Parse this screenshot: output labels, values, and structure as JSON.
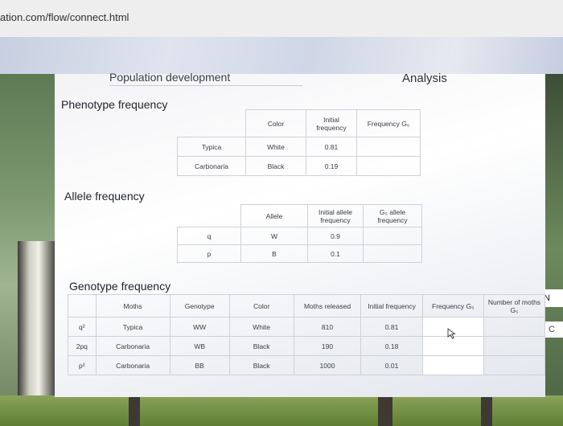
{
  "browser": {
    "url": "ation.com/flow/connect.html"
  },
  "header": {
    "title": "Population development",
    "analysis": "Analysis"
  },
  "sections": {
    "phenotype": "Phenotype frequency",
    "allele": "Allele frequency",
    "genotype": "Genotype frequency"
  },
  "phenotype_table": {
    "headers": [
      "Color",
      "Initial frequency",
      "Frequency G₅"
    ],
    "rows": [
      {
        "name": "Typica",
        "color": "White",
        "initial": "0.81",
        "freq": ""
      },
      {
        "name": "Carbonaria",
        "color": "Black",
        "initial": "0.19",
        "freq": ""
      }
    ]
  },
  "allele_table": {
    "headers": [
      "Allele",
      "Initial allele frequency",
      "G₅ allele frequency"
    ],
    "rows": [
      {
        "sym": "q",
        "allele": "W",
        "initial": "0.9",
        "g5": ""
      },
      {
        "sym": "p",
        "allele": "B",
        "initial": "0.1",
        "g5": ""
      }
    ]
  },
  "genotype_table": {
    "headers": [
      "Moths",
      "Genotype",
      "Color",
      "Moths released",
      "Initial frequency",
      "Frequency G₅",
      "Number of moths G₅"
    ],
    "rows": [
      {
        "sym": "q²",
        "moth": "Typica",
        "genotype": "WW",
        "color": "White",
        "released": "810",
        "initial": "0.81",
        "freq": "",
        "number": ""
      },
      {
        "sym": "2pq",
        "moth": "Carbonaria",
        "genotype": "WB",
        "color": "Black",
        "released": "190",
        "initial": "0.18",
        "freq": "",
        "number": ""
      },
      {
        "sym": "p²",
        "moth": "Carbonaria",
        "genotype": "BB",
        "color": "Black",
        "released": "1000",
        "initial": "0.01",
        "freq": "",
        "number": ""
      }
    ]
  },
  "side_tabs": {
    "top": "N",
    "bottom": "C"
  }
}
